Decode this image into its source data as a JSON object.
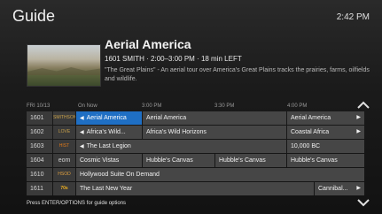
{
  "header": {
    "title": "Guide",
    "clock": "2:42 PM"
  },
  "program": {
    "title": "Aerial America",
    "meta": "1601 SMITH  ·  2:00–3:00 PM  ·  18 min LEFT",
    "description": "\"The Great Plains\" - An aerial tour over America's Great Plains tracks the prairies, farms, oilfields and wildlife."
  },
  "timebar": {
    "date": "FRI 10/13",
    "now": "On Now",
    "t1": "3:00 PM",
    "t2": "3:30 PM",
    "t3": "4:00 PM"
  },
  "rows": [
    {
      "channel": "1601",
      "logo": "SMITHSONIAN",
      "cells": [
        "Aerial America",
        "Aerial America",
        "Aerial America"
      ]
    },
    {
      "channel": "1602",
      "logo": "LOVE NATURE",
      "cells": [
        "Africa's Wild...",
        "Africa's Wild Horizons",
        "Coastal Africa"
      ]
    },
    {
      "channel": "1603",
      "logo": "HIST",
      "cells": [
        "The Last Legion",
        "10,000 BC"
      ]
    },
    {
      "channel": "1604",
      "logo": "eom",
      "cells": [
        "Cosmic Vistas",
        "Hubble's Canvas",
        "Hubble's Canvas",
        "Hubble's Canvas"
      ]
    },
    {
      "channel": "1610",
      "logo": "HSOD",
      "cells": [
        "Hollywood Suite On Demand"
      ]
    },
    {
      "channel": "1611",
      "logo": "70s movies",
      "cells": [
        "The Last New Year",
        "Cannibal..."
      ]
    }
  ],
  "footer": {
    "hint": "Press ENTER/OPTIONS for guide options"
  },
  "colors": {
    "selected": "#1f6fc4",
    "cell": "#464646",
    "background": "#141414"
  }
}
